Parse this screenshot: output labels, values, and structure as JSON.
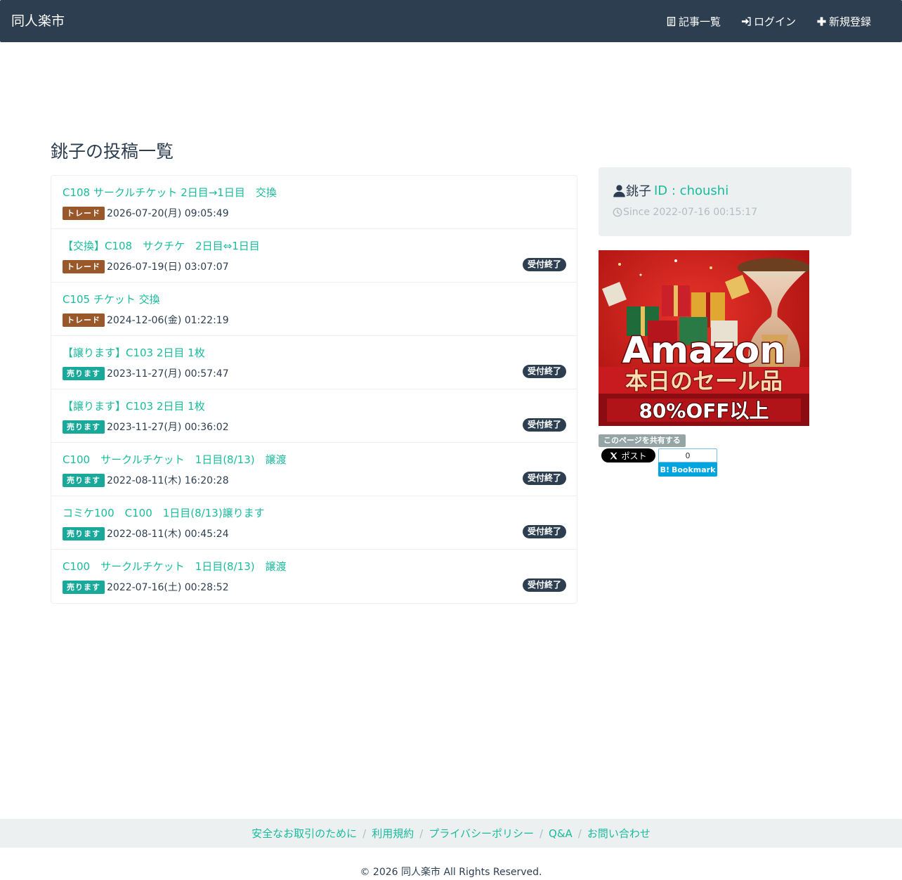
{
  "navbar": {
    "brand": "同人楽市",
    "links": [
      {
        "label": "記事一覧",
        "icon": "list-icon"
      },
      {
        "label": "ログイン",
        "icon": "login-icon"
      },
      {
        "label": "新規登録",
        "icon": "plus-icon"
      }
    ]
  },
  "page": {
    "title": "銚子の投稿一覧"
  },
  "categories": {
    "trade": {
      "label": "トレード",
      "color": "#99582a"
    },
    "sell": {
      "label": "売ります",
      "color": "#18a99a"
    }
  },
  "status_closed": "受付終了",
  "posts": [
    {
      "title": "C108 サークルチケット 2日目→1日目　交換",
      "category": "trade",
      "category_label": "トレード",
      "date": "2026-07-20(月) 09:05:49",
      "status": ""
    },
    {
      "title": "【交換】C108　サクチケ　2日目⇔1日目",
      "category": "trade",
      "category_label": "トレード",
      "date": "2026-07-19(日) 03:07:07",
      "status": "受付終了"
    },
    {
      "title": "C105 チケット 交換",
      "category": "trade",
      "category_label": "トレード",
      "date": "2024-12-06(金) 01:22:19",
      "status": ""
    },
    {
      "title": "【譲ります】C103 2日目 1枚",
      "category": "sell",
      "category_label": "売ります",
      "date": "2023-11-27(月) 00:57:47",
      "status": "受付終了"
    },
    {
      "title": "【譲ります】C103 2日目 1枚",
      "category": "sell",
      "category_label": "売ります",
      "date": "2023-11-27(月) 00:36:02",
      "status": "受付終了"
    },
    {
      "title": "C100　サークルチケット　1日目(8/13)　譲渡",
      "category": "sell",
      "category_label": "売ります",
      "date": "2022-08-11(木) 16:20:28",
      "status": "受付終了"
    },
    {
      "title": "コミケ100　C100　1日目(8/13)譲ります",
      "category": "sell",
      "category_label": "売ります",
      "date": "2022-08-11(木) 00:45:24",
      "status": "受付終了"
    },
    {
      "title": "C100　サークルチケット　1日目(8/13)　譲渡",
      "category": "sell",
      "category_label": "売ります",
      "date": "2022-07-16(土) 00:28:52",
      "status": "受付終了"
    }
  ],
  "profile": {
    "name": "銚子",
    "id_text": "ID : choushi",
    "since": "Since 2022-07-16 00:15:17"
  },
  "ad": {
    "brand": "Amazon",
    "line1": "本日のセール品",
    "line2": "80%OFF以上"
  },
  "share": {
    "label": "このページを共有する",
    "x_post": "ポスト",
    "hatena_count": "0",
    "hatena_label": "Bookmark"
  },
  "footer": {
    "links": [
      "安全なお取引のために",
      "利用規約",
      "プライバシーポリシー",
      "Q&A",
      "お問い合わせ"
    ],
    "separator": "/",
    "copyright": "© 2026 同人楽市 All Rights Reserved."
  },
  "colors": {
    "navbar": "#2c3e50",
    "accent": "#18bc9c",
    "well": "#ecf0f1"
  }
}
